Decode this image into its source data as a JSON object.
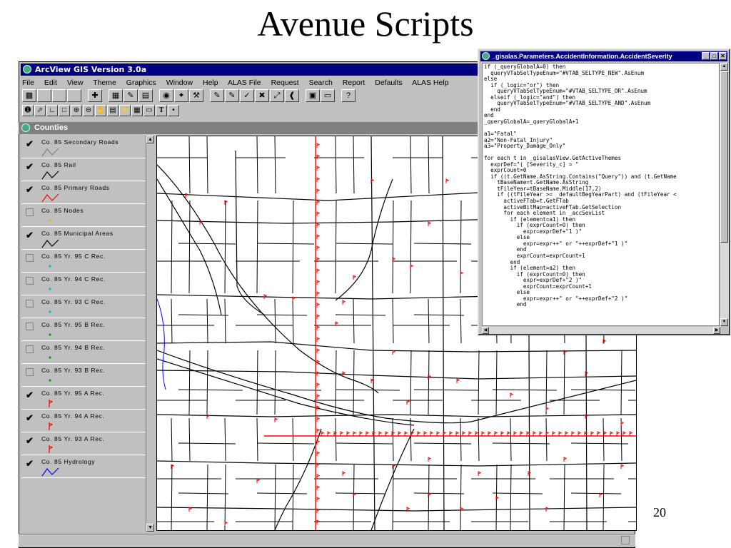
{
  "slide": {
    "title": "Avenue Scripts",
    "page_number": "20"
  },
  "arcview": {
    "title": "ArcView GIS Version 3.0a",
    "menu": [
      "File",
      "Edit",
      "View",
      "Theme",
      "Graphics",
      "Window",
      "Help",
      "ALAS File",
      "Request",
      "Search",
      "Report",
      "Defaults",
      "ALAS Help"
    ],
    "view_title": "Counties",
    "themes": [
      {
        "label": "Co. 85 Secondary Roads",
        "checked": true,
        "symbol": "line",
        "color": "#808080"
      },
      {
        "label": "Co. 85 Rail",
        "checked": true,
        "symbol": "line",
        "color": "#000000"
      },
      {
        "label": "Co. 85 Primary Roads",
        "checked": true,
        "symbol": "line",
        "color": "#ff0000"
      },
      {
        "label": "Co. 85 Nodes",
        "checked": false,
        "symbol": "dot",
        "color": "#d0c000"
      },
      {
        "label": "Co. 85 Municipal Areas",
        "checked": true,
        "symbol": "line",
        "color": "#000000"
      },
      {
        "label": "Co. 85 Yr. 95 C Rec.",
        "checked": false,
        "symbol": "dot",
        "color": "#00c0c0"
      },
      {
        "label": "Co. 85 Yr. 94 C Rec.",
        "checked": false,
        "symbol": "dot",
        "color": "#00c0c0"
      },
      {
        "label": "Co. 85 Yr. 93 C Rec.",
        "checked": false,
        "symbol": "dot",
        "color": "#00c0c0"
      },
      {
        "label": "Co. 85 Yr. 95 B Rec.",
        "checked": false,
        "symbol": "dot",
        "color": "#00a000"
      },
      {
        "label": "Co. 85 Yr. 94 B Rec.",
        "checked": false,
        "symbol": "dot",
        "color": "#00a000"
      },
      {
        "label": "Co. 85 Yr. 93 B Rec.",
        "checked": false,
        "symbol": "dot",
        "color": "#00a000"
      },
      {
        "label": "Co. 85 Yr. 95 A Rec.",
        "checked": true,
        "symbol": "flag",
        "color": "#ff0000"
      },
      {
        "label": "Co. 85 Yr. 94 A Rec.",
        "checked": true,
        "symbol": "flag",
        "color": "#ff0000"
      },
      {
        "label": "Co. 85 Yr. 93 A Rec.",
        "checked": true,
        "symbol": "flag",
        "color": "#ff0000"
      },
      {
        "label": "Co. 85 Hydrology",
        "checked": true,
        "symbol": "line",
        "color": "#0000ff"
      }
    ]
  },
  "script_window": {
    "title": "_gisalas.Parameters.AccidentInformation.AccidentSeverity",
    "code": "if (_queryGlobalA=0) then\n  queryVTabSelTypeEnum=\"#VTAB_SELTYPE_NEW\".AsEnum\nelse\n  if (_logic=\"or\") then\n    queryVTabSelTypeEnum=\"#VTAB_SELTYPE_OR\".AsEnum\n  elseif (_logic=\"and\") then\n    queryVTabSelTypeEnum=\"#VTAB_SELTYPE_AND\".AsEnum\n  end\nend\n_queryGlobalA=_queryGlobalA+1\n\na1=\"Fatal\"\na2=\"Non-Fatal_Injury\"\na3=\"Property_Damage_Only\"\n\nfor each t in _gisalasView.GetActiveThemes\n  exprDef=\"( [Severity_c] = \"\n  exprCount=0\n  if ((t.GetName.AsString.Contains(\"Query\")) and (t.GetName\n    tBaseName=t.GetName.AsString\n    tFileYear=tBaseName.Middle(17,2)\n    if ((tFileYear >= _defaultBegYearPart) and (tFileYear <\n      activeFTab=t.GetFTab\n      activeBitMap=activeFTab.GetSelection\n      for each element in _accSevList\n        if (element=a1) then\n          if (exprCount=0) then\n            expr=exprDef+\"1 )\"\n          else\n            expr=expr++\" or \"++exprDef+\"1 )\"\n          end\n          exprCount=exprCount+1\n        end\n        if (element=a2) then\n          if (exprCount=0) then\n            expr=exprDef+\"2 )\"\n            exprCount=exprCount+1\n          else\n            expr=expr++\" or \"++exprDef+\"2 )\"\n          end"
  }
}
